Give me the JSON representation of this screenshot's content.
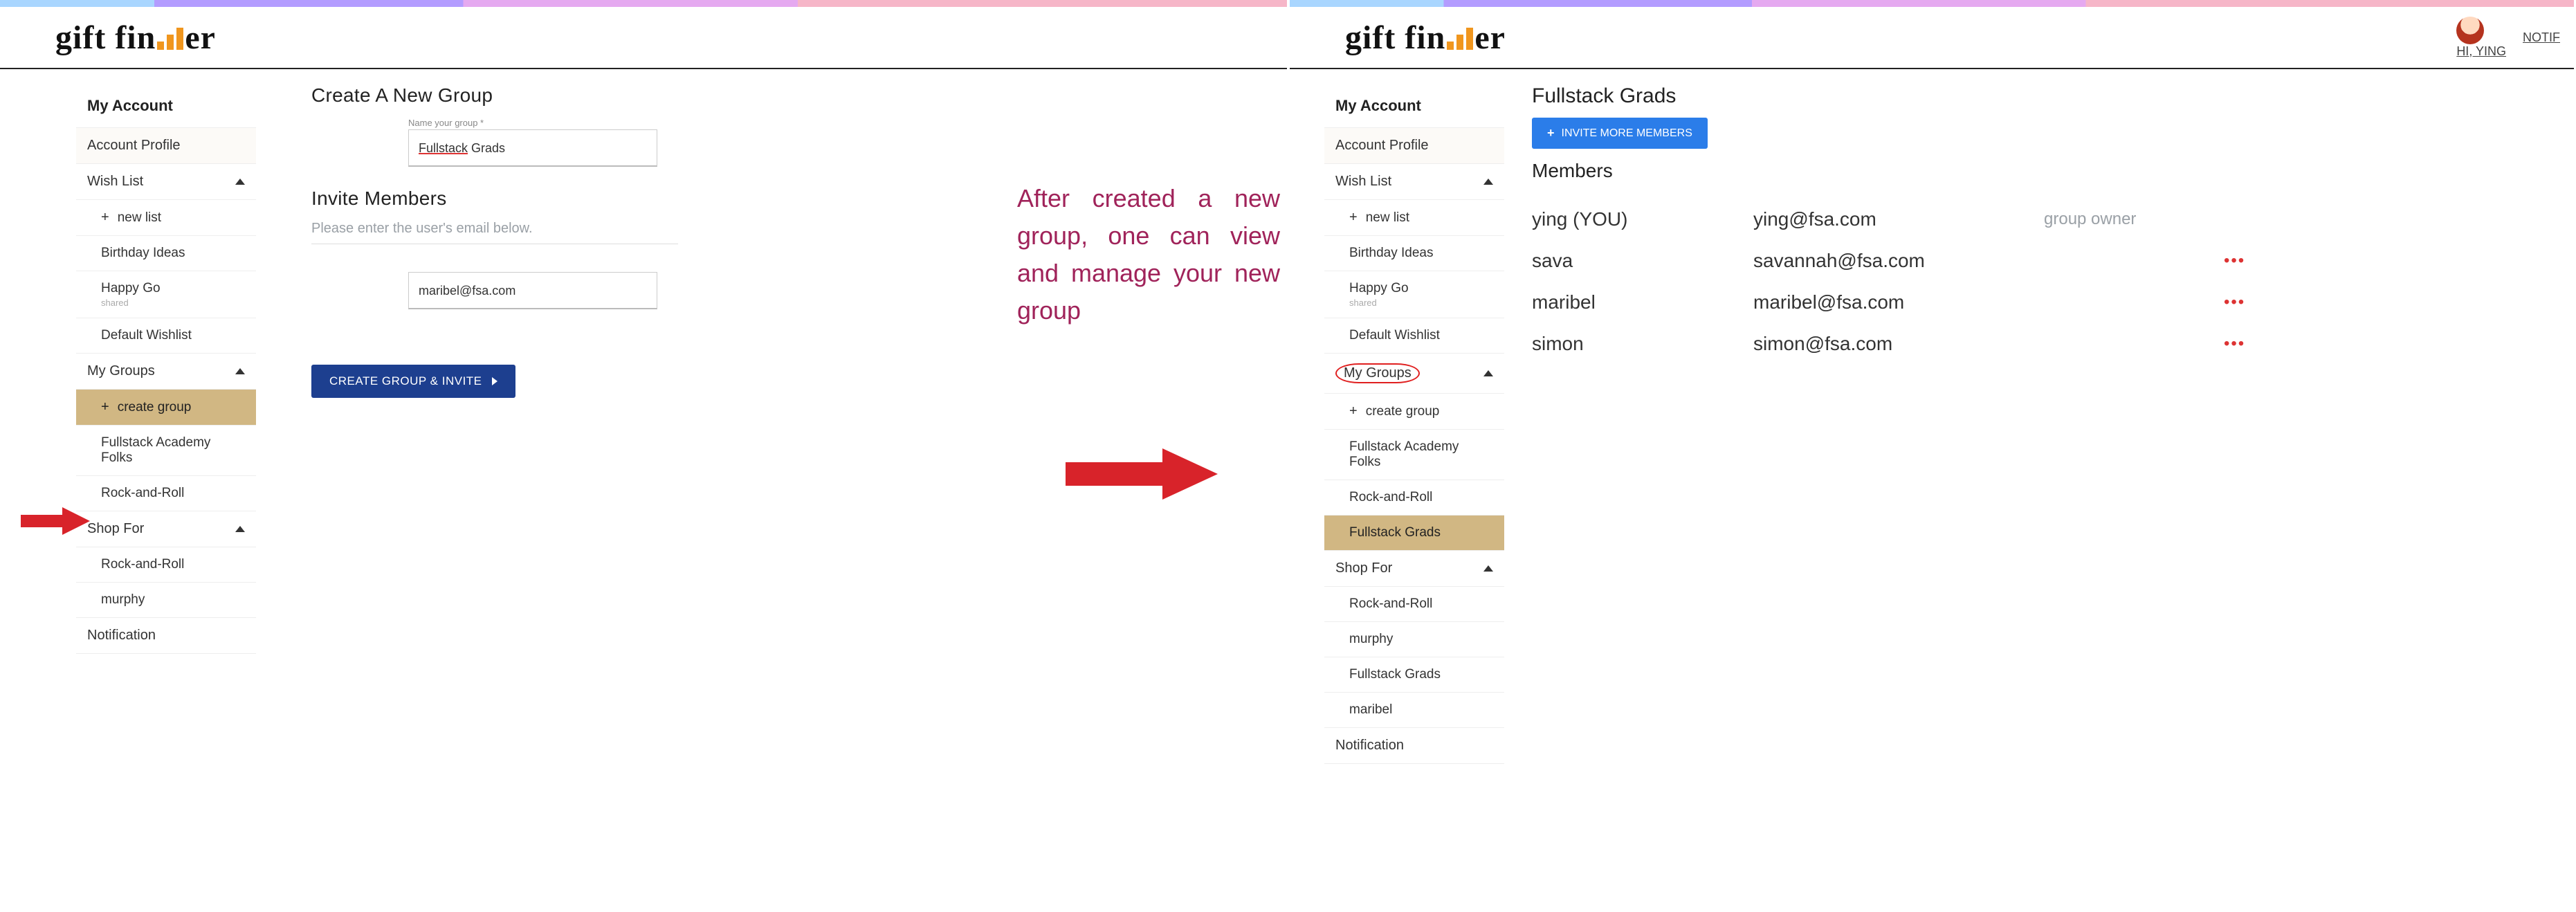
{
  "annotation": {
    "caption": "After created a new group, one can view and manage your new group"
  },
  "panel1": {
    "logo_a": "gift fin",
    "logo_b": "er",
    "sidebar": {
      "title": "My Account",
      "account_profile": "Account Profile",
      "wish_list": "Wish List",
      "new_list": "new list",
      "birthday_ideas": "Birthday Ideas",
      "happy_go": "Happy Go",
      "happy_go_sub": "shared",
      "default_wishlist": "Default Wishlist",
      "my_groups": "My Groups",
      "create_group": "create group",
      "group1": "Fullstack Academy Folks",
      "group2": "Rock-and-Roll",
      "shop_for": "Shop For",
      "shop1": "Rock-and-Roll",
      "shop2": "murphy",
      "notification": "Notification"
    },
    "main": {
      "create_heading": "Create A New Group",
      "name_label": "Name your group *",
      "name_value_a": "Fullstack",
      "name_value_b": " Grads",
      "invite_heading": "Invite Members",
      "hint": "Please enter the user's email below.",
      "email_value": "maribel@fsa.com",
      "button": "CREATE GROUP & INVITE"
    }
  },
  "panel2": {
    "logo_a": "gift fin",
    "logo_b": "er",
    "header": {
      "hi": "HI, YING",
      "notif": "NOTIF"
    },
    "sidebar": {
      "title": "My Account",
      "account_profile": "Account Profile",
      "wish_list": "Wish List",
      "new_list": "new list",
      "birthday_ideas": "Birthday Ideas",
      "happy_go": "Happy Go",
      "happy_go_sub": "shared",
      "default_wishlist": "Default Wishlist",
      "my_groups": "My Groups",
      "create_group": "create group",
      "group1": "Fullstack Academy Folks",
      "group2": "Rock-and-Roll",
      "group3": "Fullstack Grads",
      "shop_for": "Shop For",
      "shop1": "Rock-and-Roll",
      "shop2": "murphy",
      "shop3": "Fullstack Grads",
      "shop4": "maribel",
      "notification": "Notification"
    },
    "main": {
      "group_title": "Fullstack Grads",
      "invite_button": "INVITE MORE MEMBERS",
      "members_heading": "Members",
      "rows": [
        {
          "name": "ying (YOU)",
          "email": "ying@fsa.com",
          "role": "group owner",
          "dots": ""
        },
        {
          "name": "sava",
          "email": "savannah@fsa.com",
          "role": "",
          "dots": "•••"
        },
        {
          "name": "maribel",
          "email": "maribel@fsa.com",
          "role": "",
          "dots": "•••"
        },
        {
          "name": "simon",
          "email": "simon@fsa.com",
          "role": "",
          "dots": "•••"
        }
      ]
    }
  }
}
